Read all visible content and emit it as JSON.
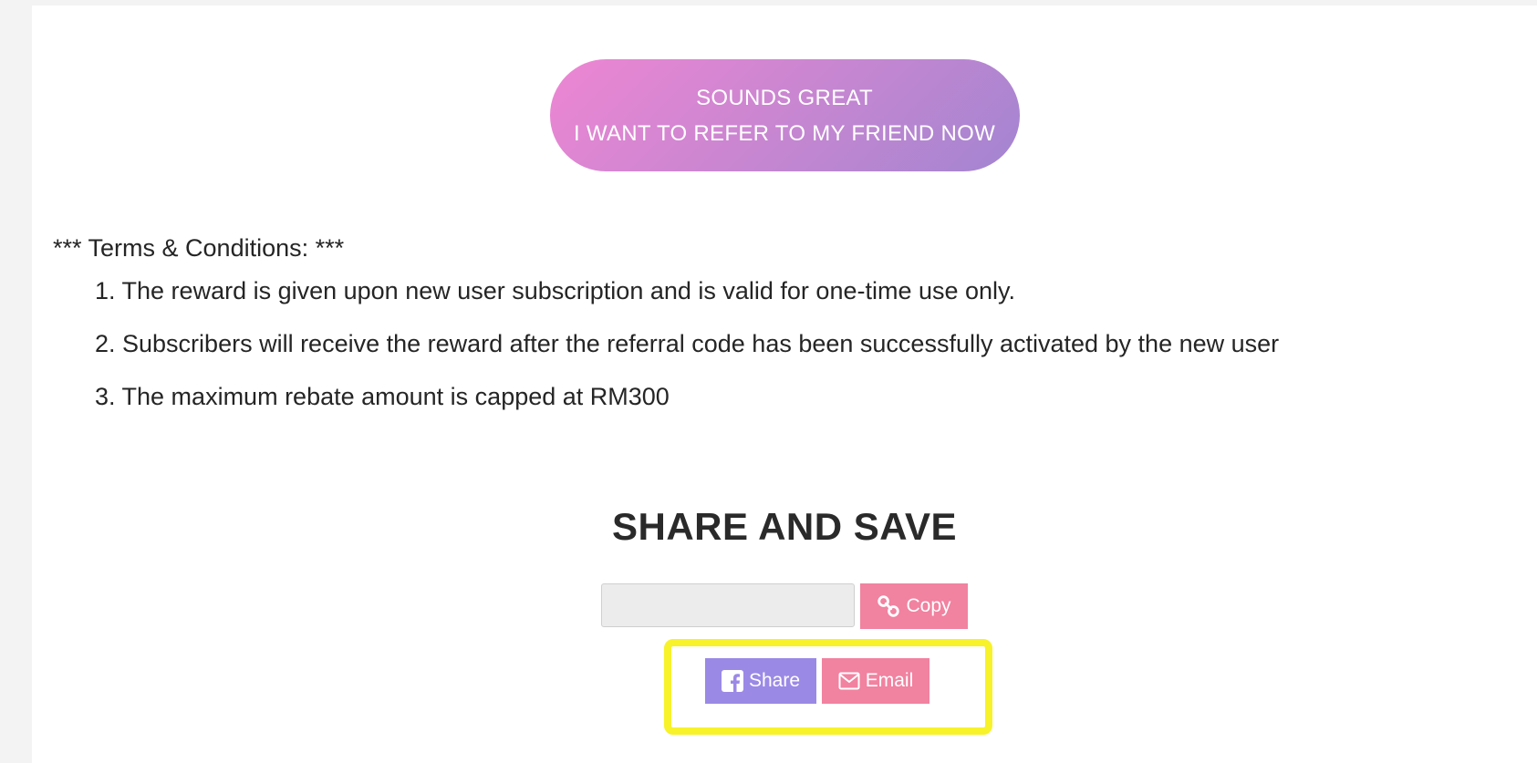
{
  "cta": {
    "line1": "SOUNDS GREAT",
    "line2": "I WANT TO REFER TO MY FRIEND NOW",
    "gradient_start": "#ee86d3",
    "gradient_end": "#a385d1"
  },
  "terms": {
    "title": "*** Terms & Conditions: ***",
    "items": [
      "1. The reward is given upon new user subscription and is valid for one-time use only.",
      "2. Subscribers will receive the reward after the referral code has been successfully activated by the new user",
      "3. The maximum rebate amount is capped at RM300"
    ]
  },
  "share": {
    "title": "SHARE AND SAVE",
    "link_value": "",
    "link_placeholder": "",
    "copy_label": "Copy",
    "copy_icon": "link-icon",
    "share_label": "Share",
    "share_icon": "facebook-icon",
    "email_label": "Email",
    "email_icon": "envelope-icon",
    "share_color": "#9b89e6",
    "pink_color": "#f182a0",
    "highlight_color": "#f7f22a"
  }
}
